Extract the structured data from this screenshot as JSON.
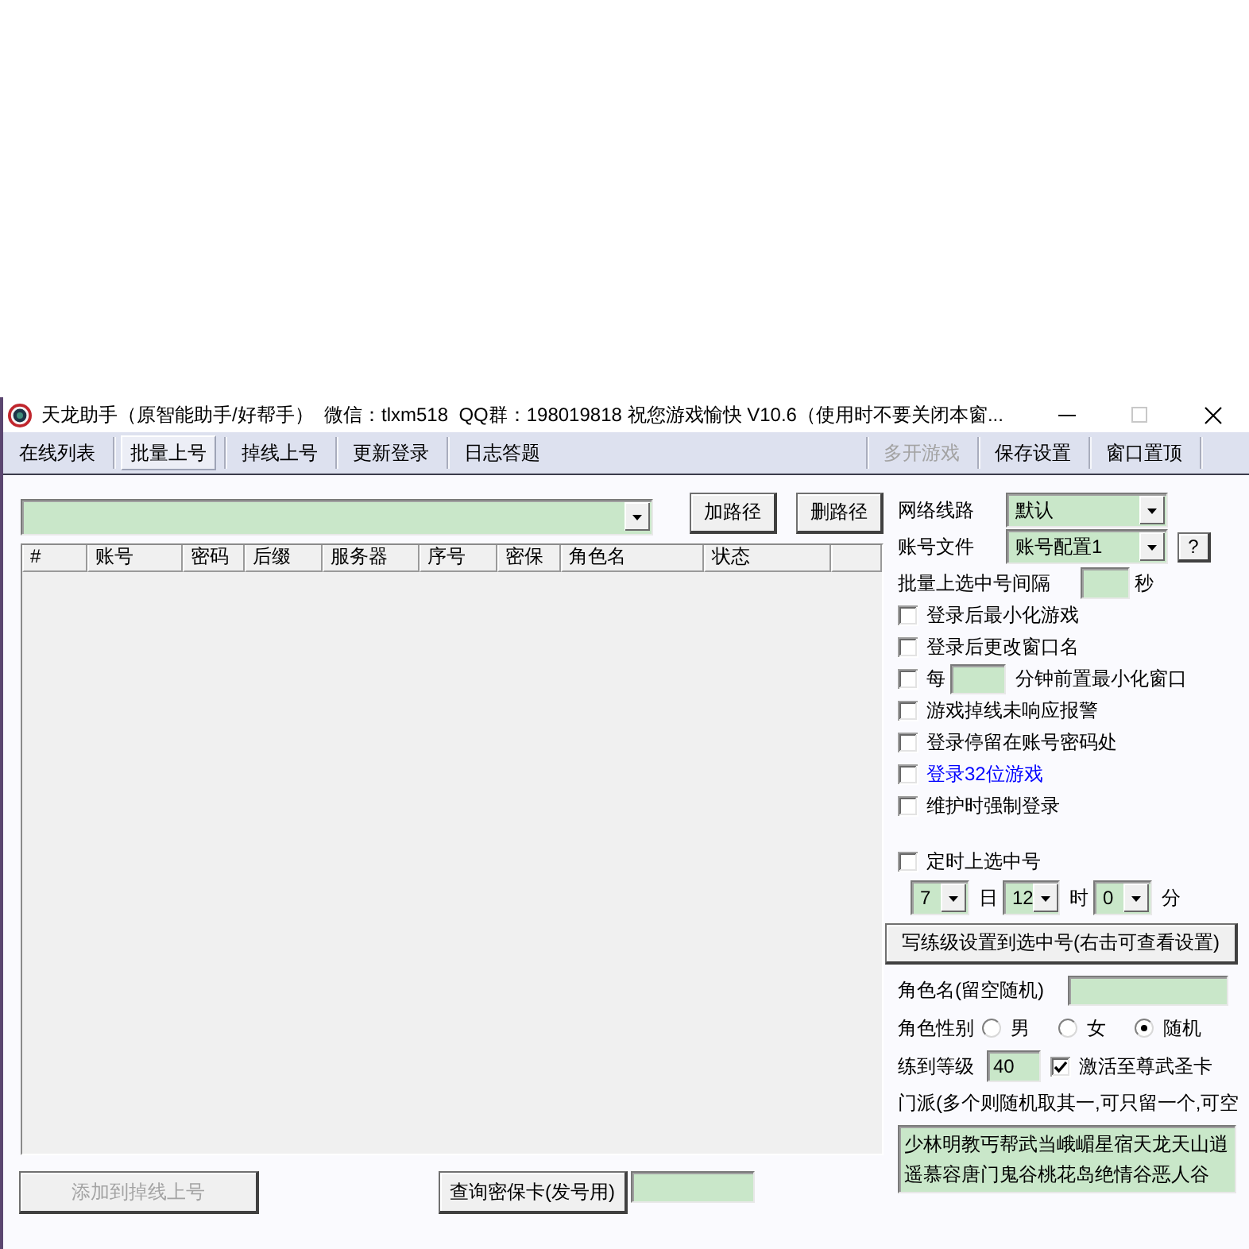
{
  "window": {
    "title": "天龙助手（原智能助手/好帮手）  微信：tlxm518  QQ群：198019818 祝您游戏愉快 V10.6（使用时不要关闭本窗...",
    "controls": [
      {
        "kind": "minimize",
        "disabled": false
      },
      {
        "kind": "maximize",
        "disabled": true
      },
      {
        "kind": "close",
        "disabled": false
      }
    ]
  },
  "toolbar": {
    "tabs": [
      {
        "label": "在线列表",
        "selected": false
      },
      {
        "label": "批量上号",
        "selected": true
      },
      {
        "label": "掉线上号",
        "selected": false
      },
      {
        "label": "更新登录",
        "selected": false
      },
      {
        "label": "日志答题",
        "selected": false
      }
    ],
    "actions": [
      {
        "label": "多开游戏",
        "disabled": true
      },
      {
        "label": "保存设置",
        "disabled": false
      },
      {
        "label": "窗口置顶",
        "disabled": false
      }
    ]
  },
  "path_bar": {
    "buttons": [
      "加路径",
      "删路径"
    ]
  },
  "account_table": {
    "columns": [
      "#",
      "账号",
      "密码",
      "后缀",
      "服务器",
      "序号",
      "密保",
      "角色名",
      "状态"
    ]
  },
  "settings": {
    "network_route": {
      "label": "网络线路",
      "value": "默认"
    },
    "account_file": {
      "label": "账号文件",
      "value": "账号配置1",
      "help": "?"
    },
    "batch_interval": {
      "label": "批量上选中号间隔",
      "unit": "秒"
    },
    "options": [
      {
        "kind": "plain",
        "label": "登录后最小化游戏",
        "checked": false,
        "color": "#000000"
      },
      {
        "kind": "plain",
        "label": "登录后更改窗口名",
        "checked": false,
        "color": "#000000"
      },
      {
        "kind": "minutes",
        "prefix": "每",
        "label": "分钟前置最小化窗口",
        "checked": false,
        "color": "#000000"
      },
      {
        "kind": "plain",
        "label": "游戏掉线未响应报警",
        "checked": false,
        "color": "#000000"
      },
      {
        "kind": "plain",
        "label": "登录停留在账号密码处",
        "checked": false,
        "color": "#000000"
      },
      {
        "kind": "plain",
        "label": "登录32位游戏",
        "checked": false,
        "color": "#0000ff"
      },
      {
        "kind": "plain",
        "label": "维护时强制登录",
        "checked": false,
        "color": "#000000"
      }
    ],
    "timer": {
      "label": "定时上选中号",
      "checked": false,
      "fields": [
        {
          "value": "7",
          "unit": "日"
        },
        {
          "value": "12",
          "unit": "时"
        },
        {
          "value": "0",
          "unit": "分"
        }
      ]
    },
    "write_button": "写练级设置到选中号(右击可查看设置)",
    "role_name": {
      "label": "角色名(留空随机)"
    },
    "gender": {
      "label": "角色性别",
      "options": [
        {
          "label": "男",
          "selected": false
        },
        {
          "label": "女",
          "selected": false
        },
        {
          "label": "随机",
          "selected": true
        }
      ]
    },
    "level": {
      "label": "练到等级",
      "value": "40",
      "card": {
        "label": "激活至尊武圣卡",
        "checked": true
      }
    },
    "sect": {
      "label": "门派(多个则随机取其一,可只留一个,可空",
      "value": "少林明教丐帮武当峨嵋星宿天龙天山逍遥慕容唐门鬼谷桃花岛绝情谷恶人谷"
    }
  },
  "bottom": {
    "buttons": [
      {
        "label": "添加到掉线上号",
        "disabled": true
      },
      {
        "label": "查询密保卡(发号用)",
        "disabled": false
      }
    ]
  }
}
